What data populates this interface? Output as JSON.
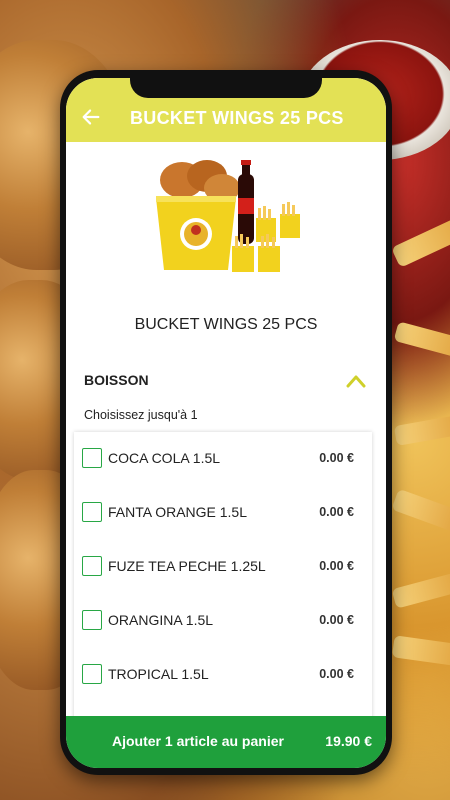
{
  "header": {
    "title": "BUCKET WINGS 25 PCS",
    "back_icon": "arrow-left-icon"
  },
  "product": {
    "title": "BUCKET WINGS 25 PCS",
    "image_icon": "bucket-meal-image"
  },
  "section": {
    "title": "BOISSON",
    "hint": "Choisissez jusqu'à 1",
    "toggle_icon": "chevron-up-icon"
  },
  "options": [
    {
      "label": "COCA COLA 1.5L",
      "price": "0.00 €"
    },
    {
      "label": "FANTA ORANGE 1.5L",
      "price": "0.00 €"
    },
    {
      "label": "FUZE TEA PECHE 1.25L",
      "price": "0.00 €"
    },
    {
      "label": "ORANGINA 1.5L",
      "price": "0.00 €"
    },
    {
      "label": "TROPICAL 1.5L",
      "price": "0.00 €"
    }
  ],
  "cart": {
    "label": "Ajouter 1 article au panier",
    "price": "19.90 €"
  },
  "colors": {
    "header": "#e3e155",
    "accent": "#28a745",
    "cart_bg": "#1fa03c",
    "chevron": "#cfd02a"
  }
}
